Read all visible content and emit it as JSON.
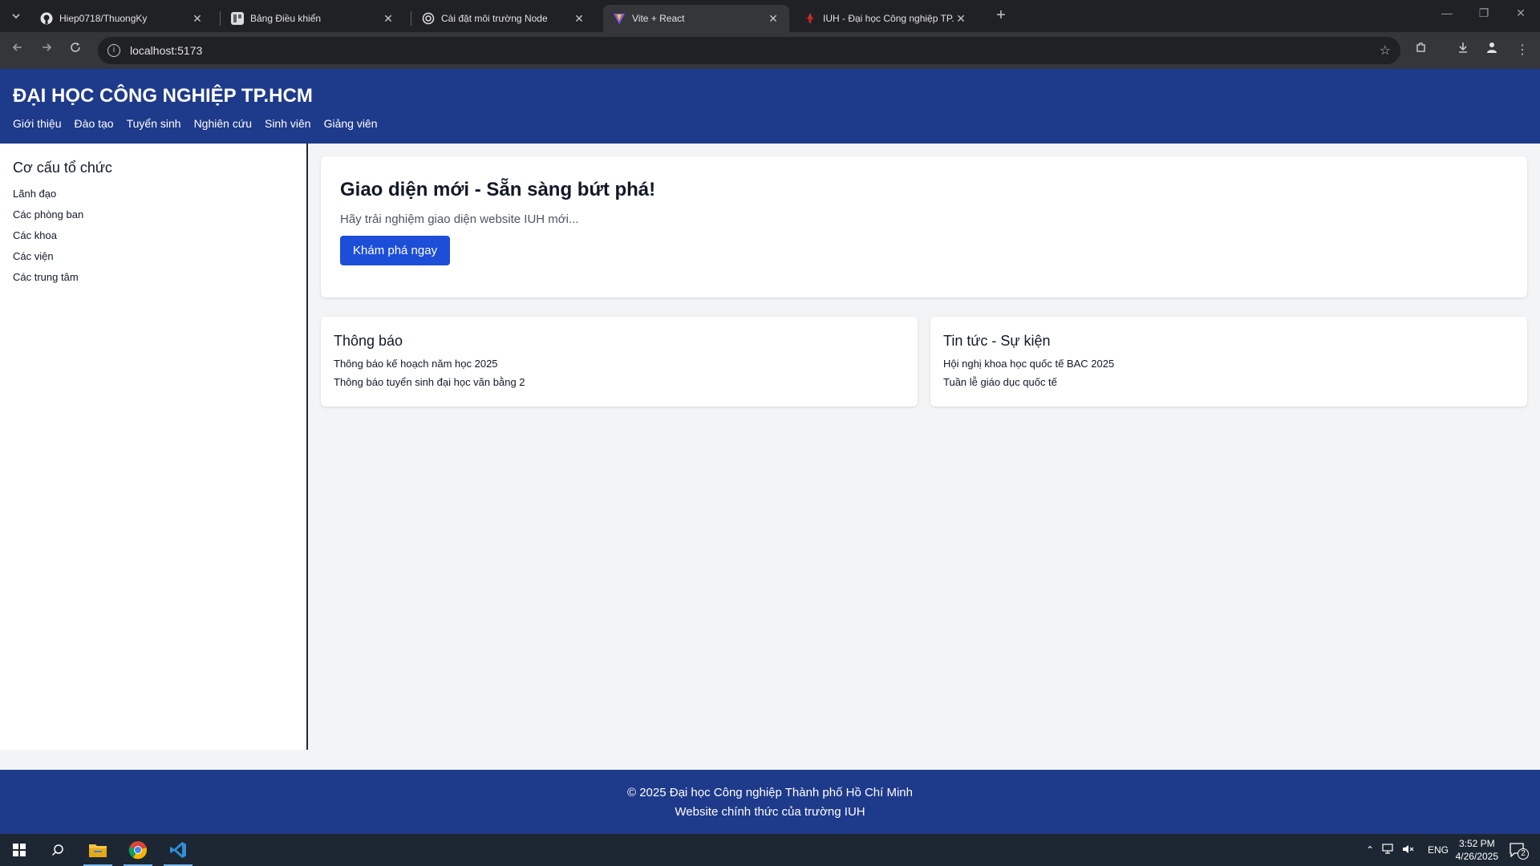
{
  "browser": {
    "tabs": [
      {
        "title": "Hiep0718/ThuongKy",
        "icon": "github-icon"
      },
      {
        "title": "Bảng Điều khiển",
        "icon": "dashboard-icon"
      },
      {
        "title": "Cài đặt môi trường Node",
        "icon": "node-icon"
      },
      {
        "title": "Vite + React",
        "icon": "vite-icon",
        "active": true
      },
      {
        "title": "IUH - Đại học Công nghiệp TP.H",
        "icon": "iuh-icon"
      }
    ],
    "url": "localhost:5173"
  },
  "site": {
    "title": "ĐẠI HỌC CÔNG NGHIỆP TP.HCM",
    "nav": [
      "Giới thiệu",
      "Đào tạo",
      "Tuyển sinh",
      "Nghiên cứu",
      "Sinh viên",
      "Giảng viên"
    ]
  },
  "sidebar": {
    "heading": "Cơ cấu tổ chức",
    "items": [
      "Lãnh đạo",
      "Các phòng ban",
      "Các khoa",
      "Các viện",
      "Các trung tâm"
    ]
  },
  "hero": {
    "title": "Giao diện mới - Sẵn sàng bứt phá!",
    "subtitle": "Hãy trải nghiệm giao diện website IUH mới...",
    "button": "Khám phá ngay"
  },
  "announcements": {
    "heading": "Thông báo",
    "items": [
      "Thông báo kế hoạch năm học 2025",
      "Thông báo tuyển sinh đại học văn bằng 2"
    ]
  },
  "news": {
    "heading": "Tin tức - Sự kiện",
    "items": [
      "Hội nghị khoa học quốc tế BAC 2025",
      "Tuần lễ giáo dục quốc tế"
    ]
  },
  "footer": {
    "line1": "© 2025 Đại học Công nghiệp Thành phố Hồ Chí Minh",
    "line2": "Website chính thức của trường IUH"
  },
  "taskbar": {
    "lang": "ENG",
    "time": "3:52 PM",
    "date": "4/26/2025",
    "notifications": "2"
  },
  "colors": {
    "header_bg": "#1e3a8a",
    "button_bg": "#1d4ed8",
    "page_bg": "#f3f4f6"
  }
}
